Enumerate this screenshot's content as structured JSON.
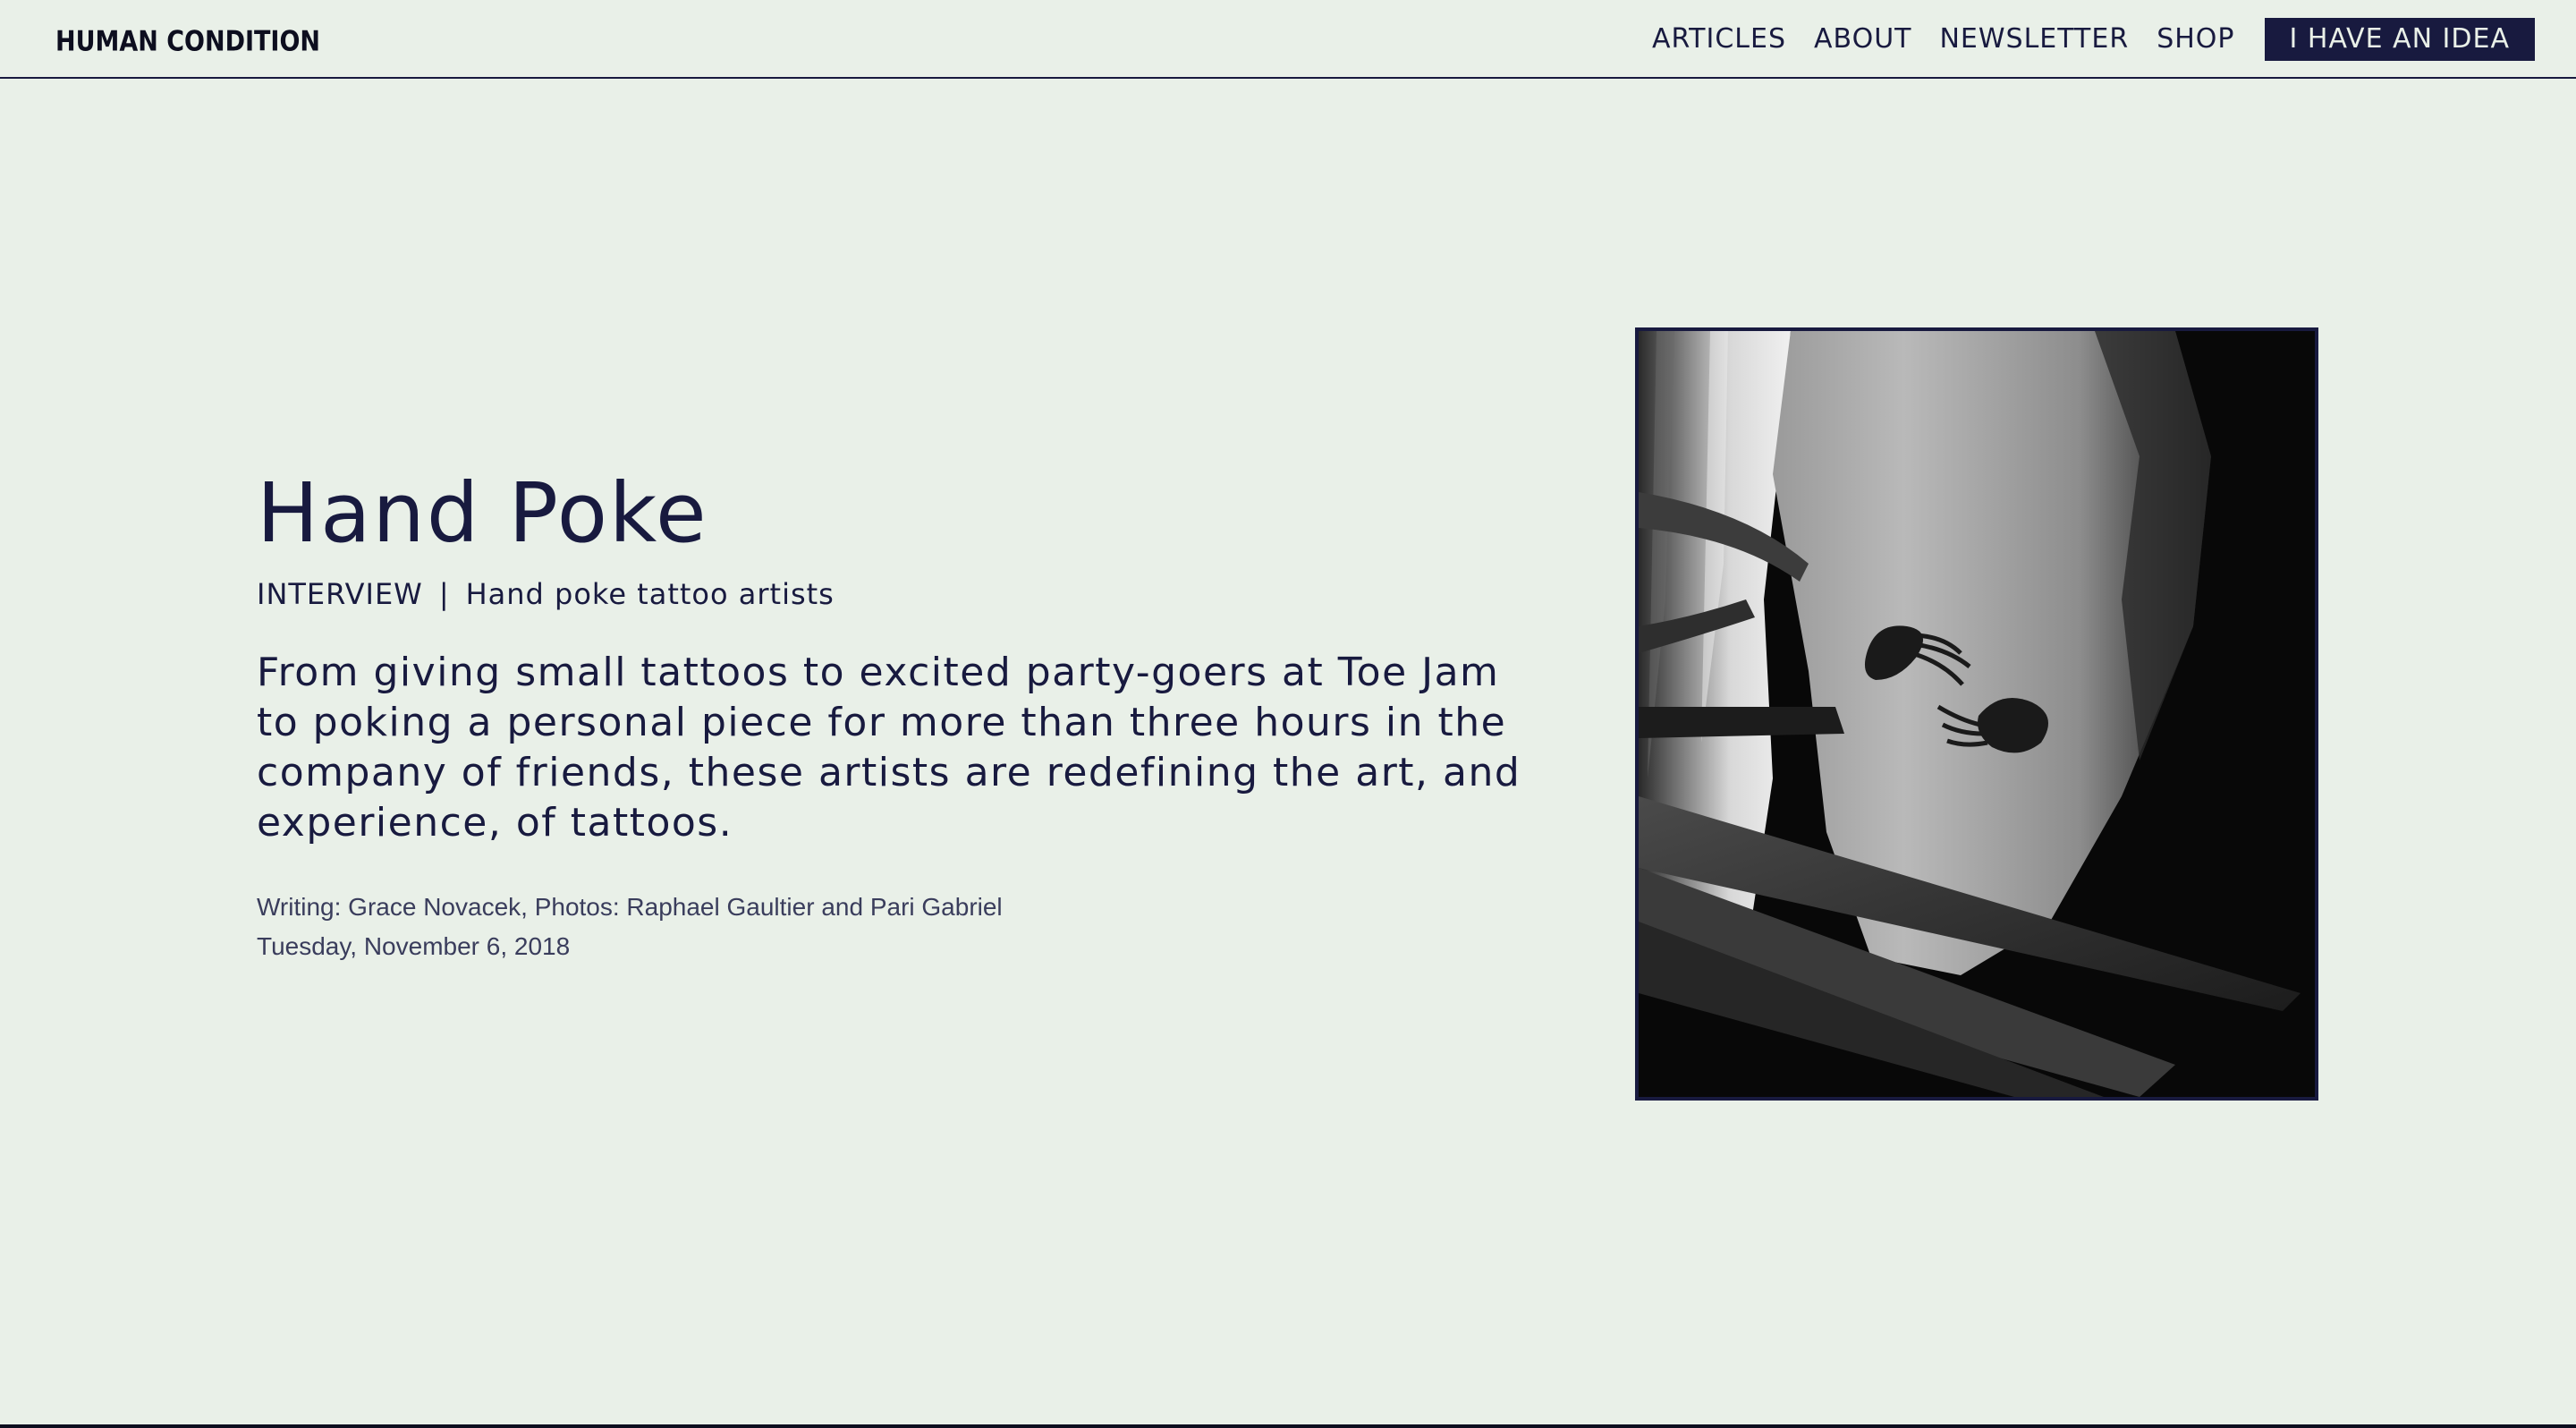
{
  "header": {
    "logo_text": "HUMAN CONDITION",
    "nav": [
      {
        "label": "ARTICLES"
      },
      {
        "label": "ABOUT"
      },
      {
        "label": "NEWSLETTER"
      },
      {
        "label": "SHOP"
      }
    ],
    "cta_label": "I HAVE AN IDEA"
  },
  "article": {
    "title": "Hand Poke",
    "category": "INTERVIEW",
    "separator": "|",
    "subtitle": "Hand poke tattoo artists",
    "dek": "From giving small tattoos to excited party-goers at Toe Jam to poking a personal piece for more than three hours in the company of friends, these artists are redefining the art, and experience, of tattoos.",
    "credits": "Writing: Grace Novacek, Photos: Raphael Gaultier and Pari Gabriel",
    "date": "Tuesday, November 6, 2018"
  },
  "colors": {
    "background": "#e9f0e8",
    "ink": "#181a3f",
    "muted": "#3a3d5c"
  }
}
